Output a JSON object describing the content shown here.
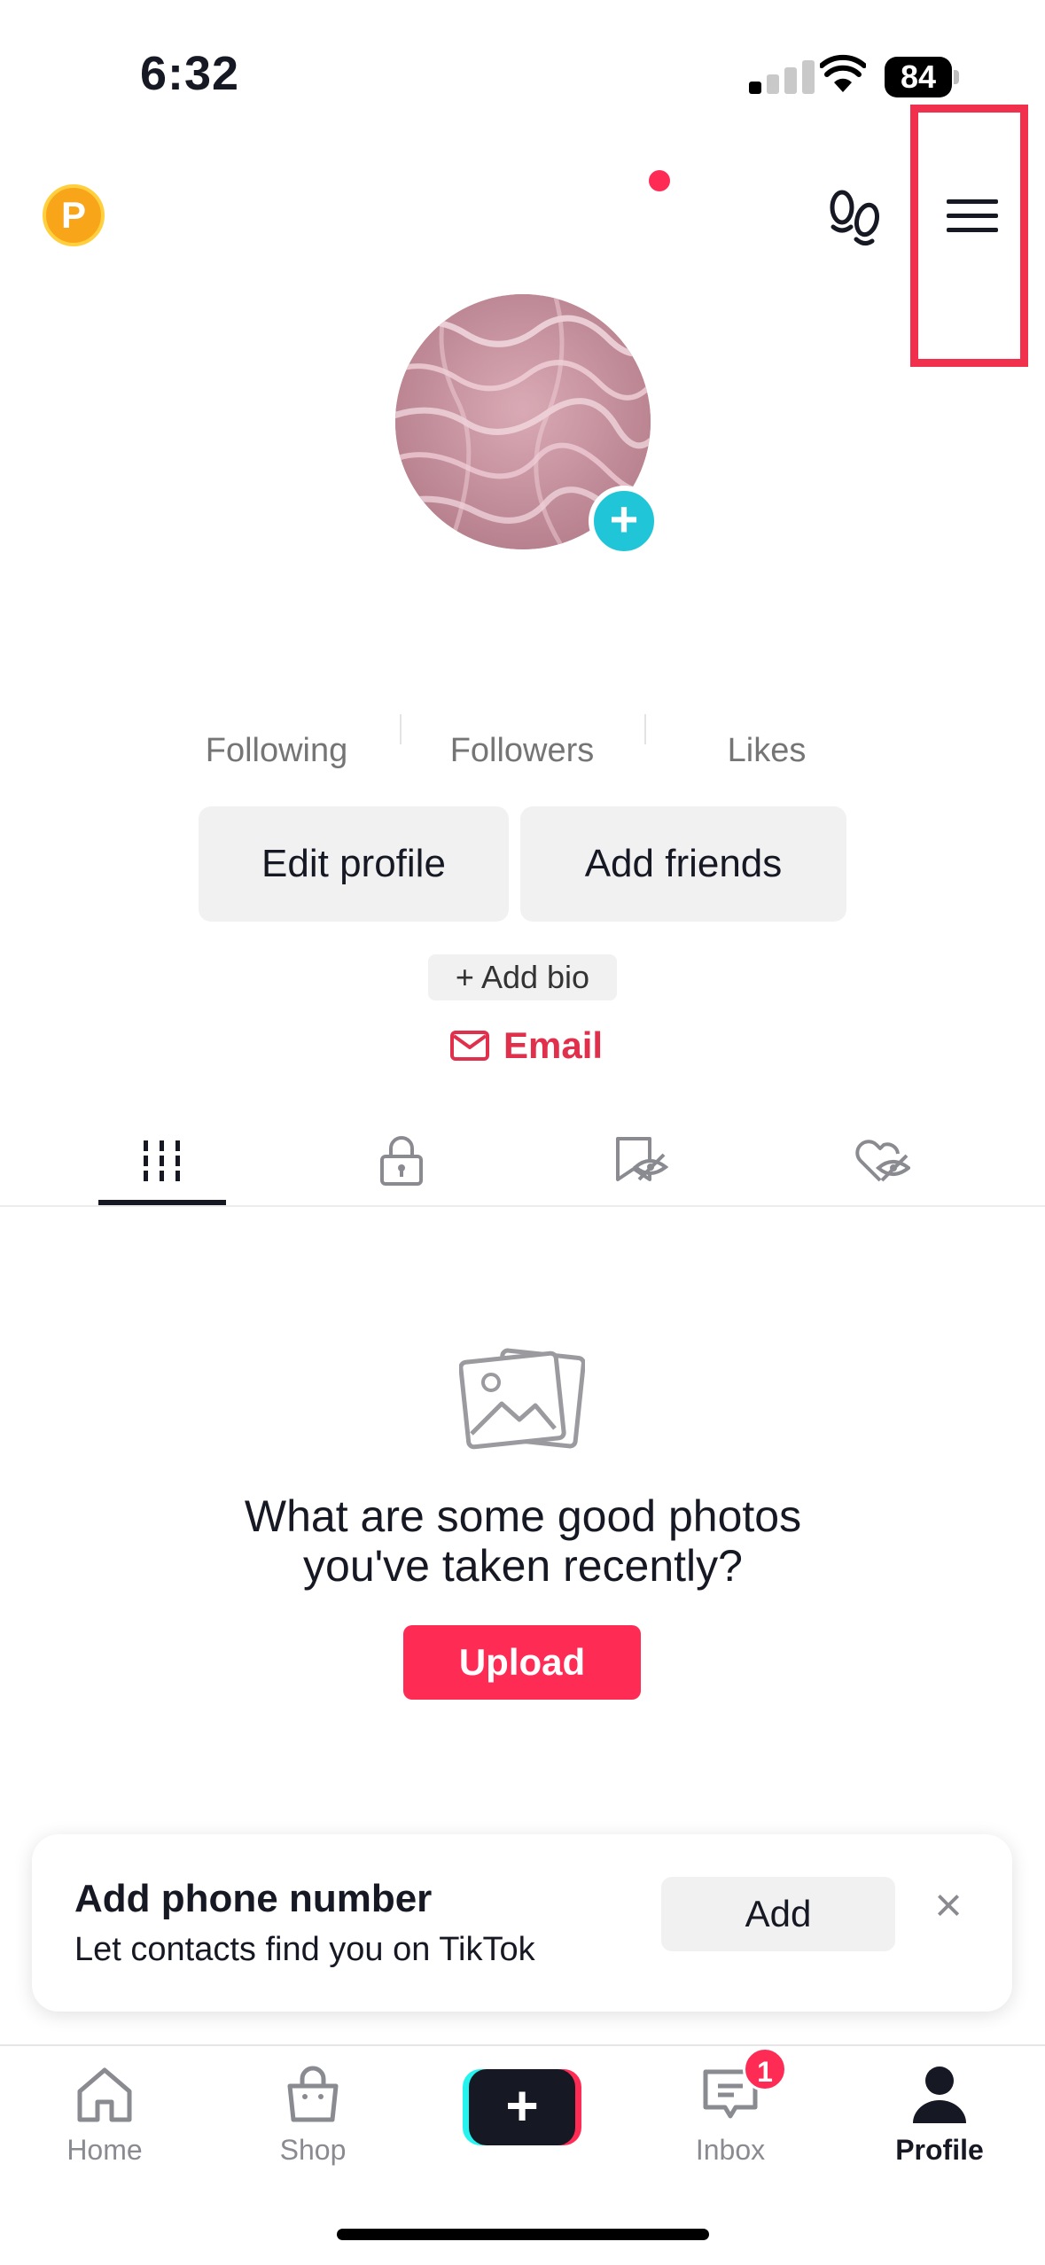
{
  "status_bar": {
    "time": "6:32",
    "battery": "84"
  },
  "header": {
    "coin_letter": "P"
  },
  "stats": [
    {
      "label": "Following"
    },
    {
      "label": "Followers"
    },
    {
      "label": "Likes"
    }
  ],
  "actions": {
    "edit_profile": "Edit profile",
    "add_friends": "Add friends"
  },
  "bio": {
    "add_bio": "+ Add bio",
    "email": "Email"
  },
  "tabs": [
    {
      "icon": "grid-icon",
      "active": true
    },
    {
      "icon": "lock-icon",
      "active": false
    },
    {
      "icon": "bookmark-hidden-icon",
      "active": false
    },
    {
      "icon": "heart-hidden-icon",
      "active": false
    }
  ],
  "empty_state": {
    "line1": "What are some good photos",
    "line2": "you've taken recently?",
    "upload": "Upload"
  },
  "banner": {
    "title": "Add phone number",
    "subtitle": "Let contacts find you on TikTok",
    "add": "Add",
    "close": "×"
  },
  "bottom_nav": {
    "home": "Home",
    "shop": "Shop",
    "create": "+",
    "inbox": "Inbox",
    "inbox_badge": "1",
    "profile": "Profile"
  },
  "colors": {
    "accent": "#fe2c55",
    "highlight_box": "#f0304c",
    "avatar_badge": "#20c5d8"
  }
}
